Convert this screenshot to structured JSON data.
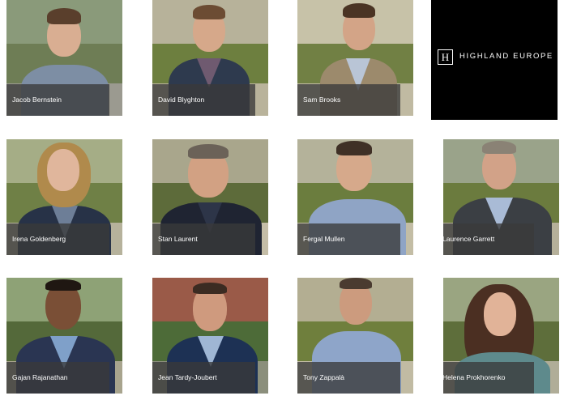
{
  "brand": {
    "logo_letter": "H",
    "logo_text": "HIGHLAND EUROPE"
  },
  "people": [
    {
      "name": "Jacob Bernstein"
    },
    {
      "name": "David Blyghton"
    },
    {
      "name": "Sam Brooks"
    },
    {
      "name": "Irena Goldenberg"
    },
    {
      "name": "Stan Laurent"
    },
    {
      "name": "Fergal Mullen"
    },
    {
      "name": "Laurence Garrett"
    },
    {
      "name": "Gajan Rajanathan"
    },
    {
      "name": "Jean Tardy-Joubert"
    },
    {
      "name": "Tony Zappalà"
    },
    {
      "name": "Helena Prokhorenko"
    }
  ],
  "colors": {
    "caption_bg": "#3a3a3a",
    "logo_bg": "#000000",
    "page_bg": "#ffffff"
  }
}
